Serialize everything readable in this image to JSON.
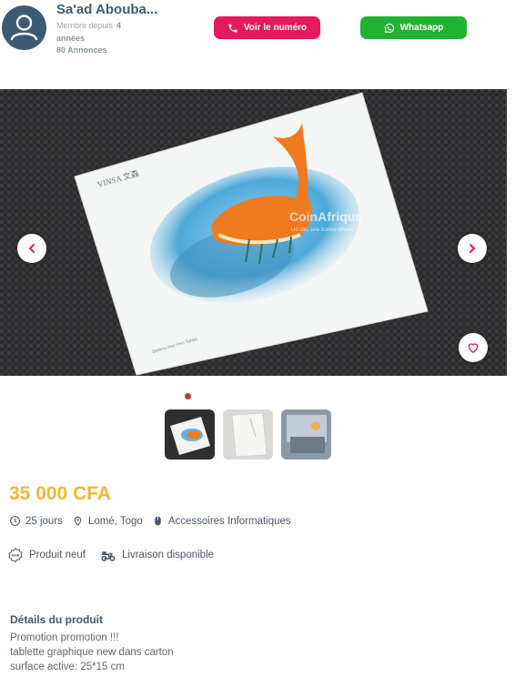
{
  "seller": {
    "name": "Sa'ad Abouba...",
    "member_since_label": "Membre depuis",
    "member_since_value": "4",
    "member_since_unit": "années",
    "ads_count": "80 Annonces",
    "avatar_icon": "user-icon"
  },
  "actions": {
    "phone_label": "Voir le numéro",
    "phone_color": "#e5195f",
    "whatsapp_label": "Whatsapp",
    "whatsapp_color": "#22b232"
  },
  "gallery": {
    "watermark_title": "CoinAfrique",
    "watermark_subtitle": "Un clic, une bonne affaire",
    "product_brand": "VINSA 文森",
    "product_caption": "Battery-free Pen Tablet",
    "image_count": 3,
    "active_index": 1
  },
  "product": {
    "price": "35 000 CFA",
    "price_color": "#f2b632",
    "posted": "25 jours",
    "location": "Lomé, Togo",
    "category": "Accessoires Informatiques",
    "condition": "Produit neuf",
    "delivery": "Livraison disponible"
  },
  "details": {
    "title": "Détails du produit",
    "lines": [
      "Promotion promotion !!!",
      "tablette graphique new dans carton",
      "surface active: 25*15 cm"
    ]
  }
}
